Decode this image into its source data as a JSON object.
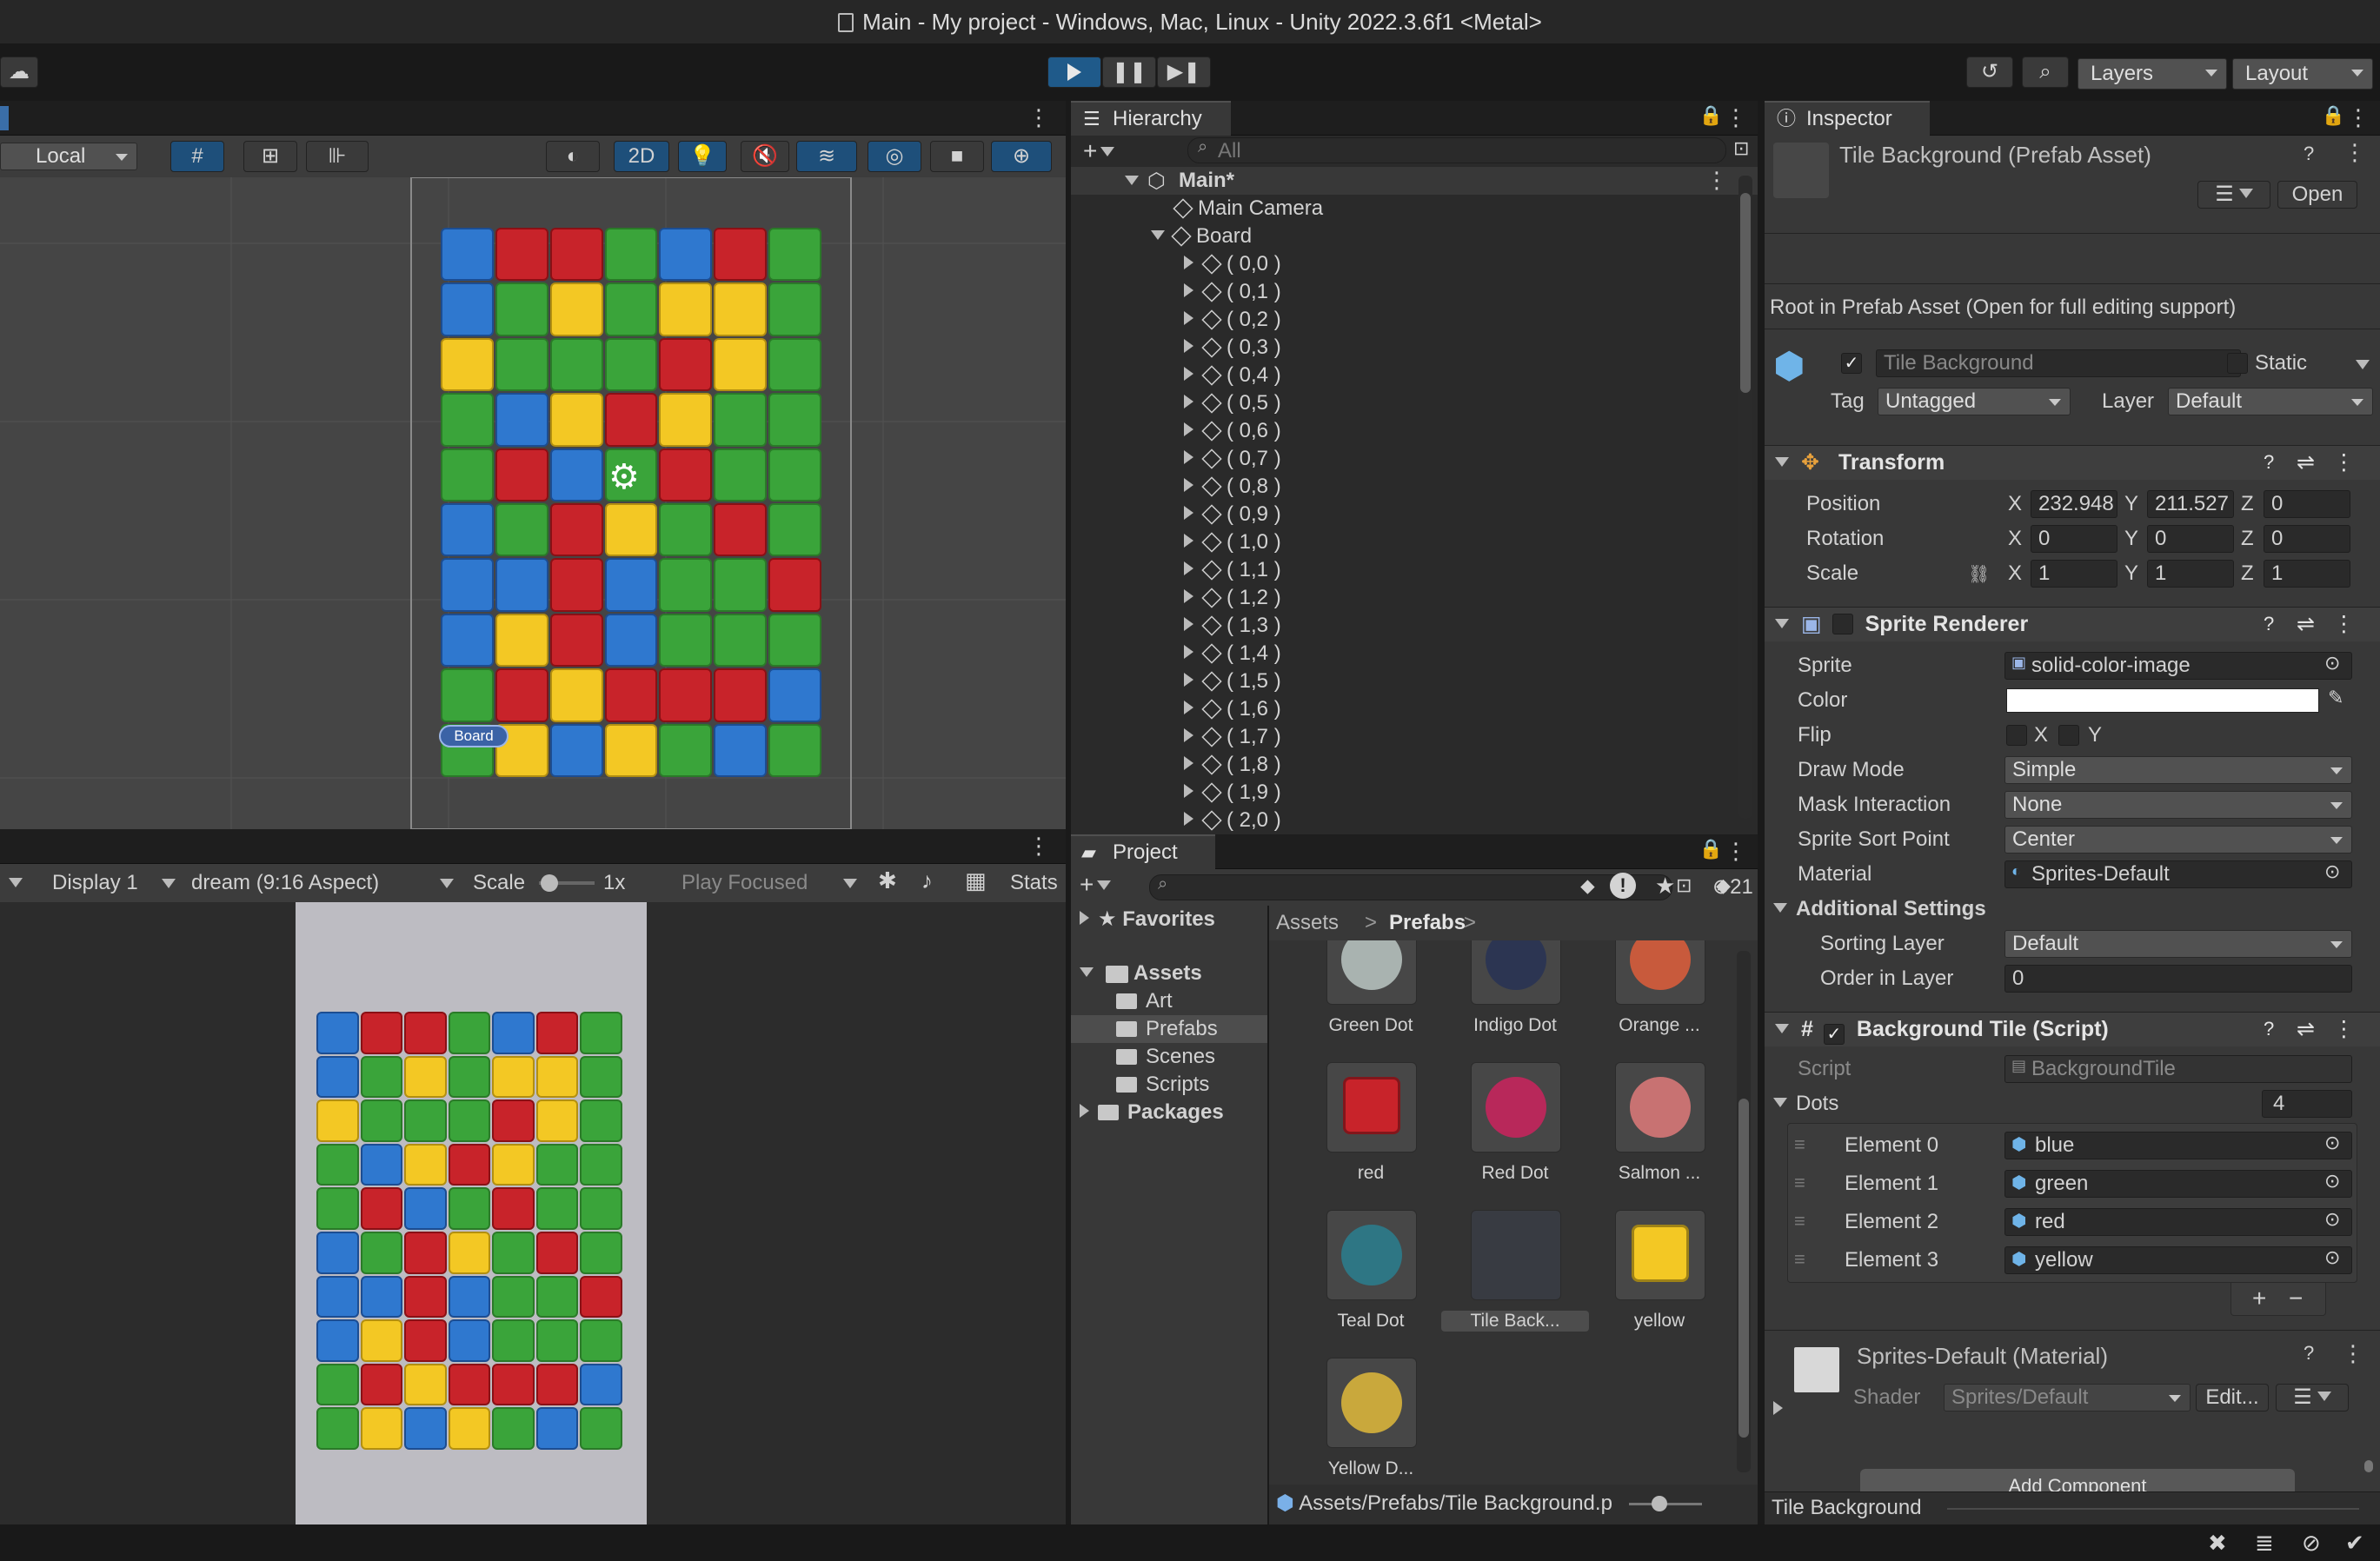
{
  "window": {
    "title": "Main - My project - Windows, Mac, Linux - Unity 2022.3.6f1 <Metal>"
  },
  "toolbar": {
    "layers": "Layers",
    "layout": "Layout"
  },
  "scene": {
    "pivot": "Local",
    "mode2d": "2D",
    "board_label": "Board"
  },
  "game": {
    "display": "Display 1",
    "aspect": "dream (9:16 Aspect)",
    "scale_label": "Scale",
    "scale_value": "1x",
    "play_focused": "Play Focused",
    "stats": "Stats"
  },
  "hierarchy": {
    "tab": "Hierarchy",
    "search_placeholder": "All",
    "scene": "Main*",
    "items": [
      "Main Camera",
      "Board"
    ],
    "children": [
      "( 0,0 )",
      "( 0,1 )",
      "( 0,2 )",
      "( 0,3 )",
      "( 0,4 )",
      "( 0,5 )",
      "( 0,6 )",
      "( 0,7 )",
      "( 0,8 )",
      "( 0,9 )",
      "( 1,0 )",
      "( 1,1 )",
      "( 1,2 )",
      "( 1,3 )",
      "( 1,4 )",
      "( 1,5 )",
      "( 1,6 )",
      "( 1,7 )",
      "( 1,8 )",
      "( 1,9 )",
      "( 2,0 )"
    ]
  },
  "project": {
    "tab": "Project",
    "hidden_count": "21",
    "favorites": "Favorites",
    "assets": "Assets",
    "folders": [
      "Art",
      "Prefabs",
      "Scenes",
      "Scripts"
    ],
    "packages": "Packages",
    "breadcrumb": [
      "Assets",
      "Prefabs"
    ],
    "items": [
      {
        "label": "Green Dot",
        "color": "#a9b3b0"
      },
      {
        "label": "Indigo Dot",
        "color": "#2c3552"
      },
      {
        "label": "Orange ...",
        "color": "#c85a3c"
      },
      {
        "label": "red",
        "color": "#c8232a"
      },
      {
        "label": "Red Dot",
        "color": "#b8285a"
      },
      {
        "label": "Salmon ...",
        "color": "#c87272"
      },
      {
        "label": "Teal Dot",
        "color": "#2e7684"
      },
      {
        "label": "Tile Back...",
        "color": "#383b42"
      },
      {
        "label": "yellow",
        "color": "#f3c824"
      },
      {
        "label": "Yellow D...",
        "color": "#c9a83c"
      }
    ],
    "status_path": "Assets/Prefabs/Tile Background.p"
  },
  "inspector": {
    "tab": "Inspector",
    "asset_title": "Tile Background (Prefab Asset)",
    "open_button": "Open",
    "root_note": "Root in Prefab Asset (Open for full editing support)",
    "name": "Tile Background",
    "static": "Static",
    "tag_label": "Tag",
    "tag": "Untagged",
    "layer_label": "Layer",
    "layer": "Default",
    "transform": {
      "title": "Transform",
      "position_label": "Position",
      "rotation_label": "Rotation",
      "scale_label": "Scale",
      "position": [
        "232.948",
        "211.527",
        "0"
      ],
      "rotation": [
        "0",
        "0",
        "0"
      ],
      "scale": [
        "1",
        "1",
        "1"
      ]
    },
    "sprite_renderer": {
      "title": "Sprite Renderer",
      "sprite_label": "Sprite",
      "sprite": "solid-color-image",
      "color_label": "Color",
      "color": "#ffffff",
      "flip_label": "Flip",
      "draw_mode_label": "Draw Mode",
      "draw_mode": "Simple",
      "mask_label": "Mask Interaction",
      "mask": "None",
      "sort_point_label": "Sprite Sort Point",
      "sort_point": "Center",
      "material_label": "Material",
      "material": "Sprites-Default",
      "additional": "Additional Settings",
      "sorting_layer_label": "Sorting Layer",
      "sorting_layer": "Default",
      "order_label": "Order in Layer",
      "order": "0"
    },
    "script": {
      "title": "Background Tile (Script)",
      "script_label": "Script",
      "script": "BackgroundTile",
      "dots_label": "Dots",
      "dots_count": "4",
      "elements": [
        {
          "label": "Element 0",
          "value": "blue"
        },
        {
          "label": "Element 1",
          "value": "green"
        },
        {
          "label": "Element 2",
          "value": "red"
        },
        {
          "label": "Element 3",
          "value": "yellow"
        }
      ]
    },
    "material": {
      "title": "Sprites-Default (Material)",
      "shader_label": "Shader",
      "shader": "Sprites/Default",
      "edit": "Edit..."
    },
    "add_component": "Add Component",
    "footer": "Tile Background"
  },
  "axes": {
    "x": "X",
    "y": "Y",
    "z": "Z"
  }
}
